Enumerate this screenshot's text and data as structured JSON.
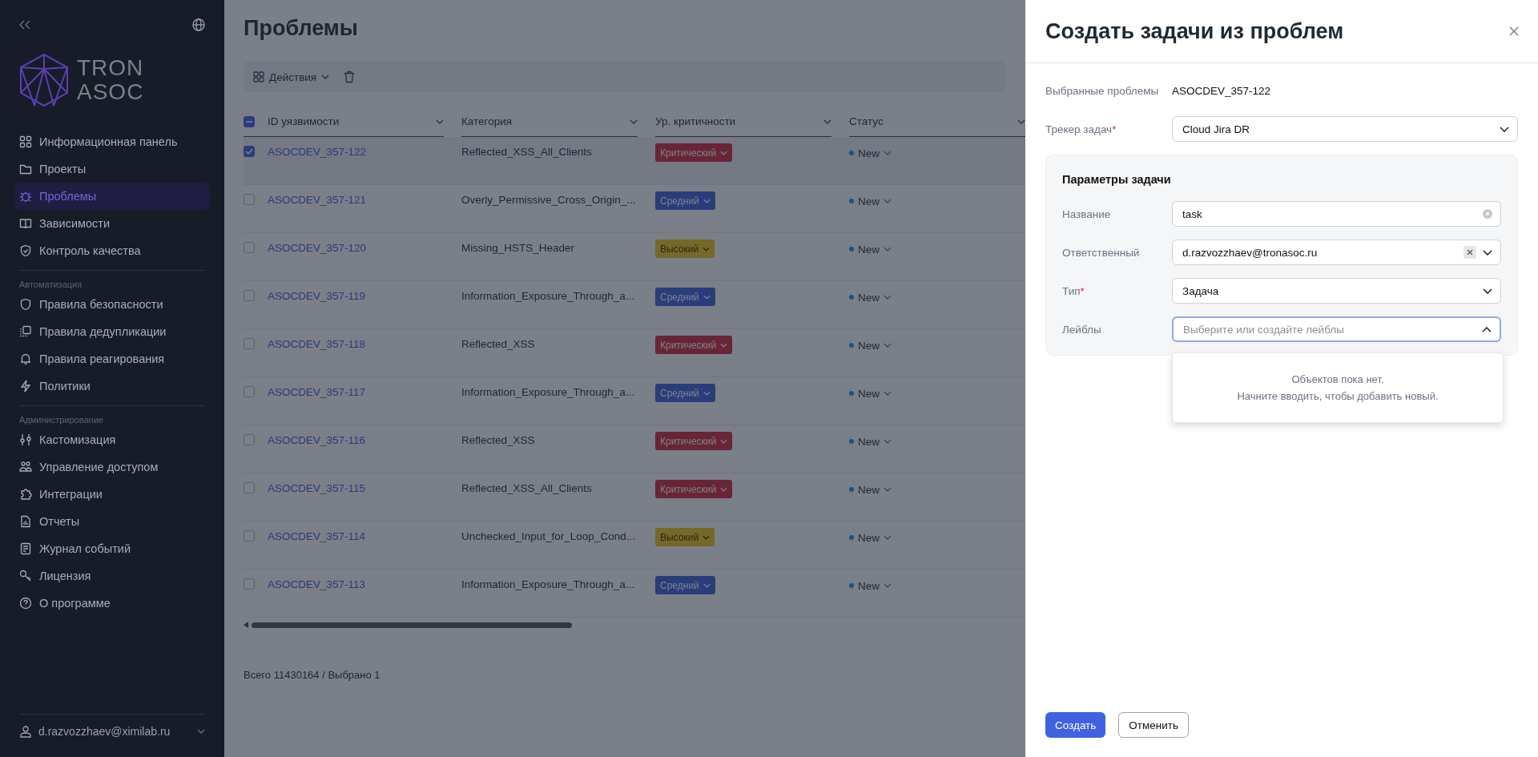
{
  "sidebar": {
    "logo": [
      "TRON",
      "ASOC"
    ],
    "groups": [
      {
        "items": [
          {
            "label": "Информационная панель",
            "selected": false
          },
          {
            "label": "Проекты",
            "selected": false
          },
          {
            "label": "Проблемы",
            "selected": true
          },
          {
            "label": "Зависимости",
            "selected": false
          },
          {
            "label": "Контроль качества",
            "selected": false
          }
        ]
      },
      {
        "heading": "Автоматизация",
        "items": [
          {
            "label": "Правила безопасности",
            "selected": false
          },
          {
            "label": "Правила дедупликации",
            "selected": false
          },
          {
            "label": "Правила реагирования",
            "selected": false
          },
          {
            "label": "Политики",
            "selected": false
          }
        ]
      },
      {
        "heading": "Администрирование",
        "items": [
          {
            "label": "Кастомизация",
            "selected": false
          },
          {
            "label": "Управление доступом",
            "selected": false
          },
          {
            "label": "Интеграции",
            "selected": false
          },
          {
            "label": "Отчеты",
            "selected": false
          },
          {
            "label": "Журнал событий",
            "selected": false
          },
          {
            "label": "Лицензия",
            "selected": false
          },
          {
            "label": "О программе",
            "selected": false
          }
        ]
      }
    ],
    "user": "d.razvozzhaev@ximilab.ru"
  },
  "page": {
    "title": "Проблемы",
    "toolbar": {
      "actions": "Действия"
    },
    "table": {
      "header_checkbox": {
        "indeterminate": true
      },
      "columns": [
        "ID уязвимости",
        "Категория",
        "Ур. критичности",
        "Статус"
      ],
      "rows": [
        {
          "id": "ASOCDEV_357-122",
          "category": "Reflected_XSS_All_Clients",
          "severity": {
            "label": "Критический",
            "kind": "critical"
          },
          "status": "New",
          "checked": true
        },
        {
          "id": "ASOCDEV_357-121",
          "category": "Overly_Permissive_Cross_Origin_...",
          "severity": {
            "label": "Средний",
            "kind": "medium"
          },
          "status": "New",
          "checked": false
        },
        {
          "id": "ASOCDEV_357-120",
          "category": "Missing_HSTS_Header",
          "severity": {
            "label": "Высокий",
            "kind": "high"
          },
          "status": "New",
          "checked": false
        },
        {
          "id": "ASOCDEV_357-119",
          "category": "Information_Exposure_Through_a...",
          "severity": {
            "label": "Средний",
            "kind": "medium"
          },
          "status": "New",
          "checked": false
        },
        {
          "id": "ASOCDEV_357-118",
          "category": "Reflected_XSS",
          "severity": {
            "label": "Критический",
            "kind": "critical"
          },
          "status": "New",
          "checked": false
        },
        {
          "id": "ASOCDEV_357-117",
          "category": "Information_Exposure_Through_a...",
          "severity": {
            "label": "Средний",
            "kind": "medium"
          },
          "status": "New",
          "checked": false
        },
        {
          "id": "ASOCDEV_357-116",
          "category": "Reflected_XSS",
          "severity": {
            "label": "Критический",
            "kind": "critical"
          },
          "status": "New",
          "checked": false
        },
        {
          "id": "ASOCDEV_357-115",
          "category": "Reflected_XSS_All_Clients",
          "severity": {
            "label": "Критический",
            "kind": "critical"
          },
          "status": "New",
          "checked": false
        },
        {
          "id": "ASOCDEV_357-114",
          "category": "Unchecked_Input_for_Loop_Cond...",
          "severity": {
            "label": "Высокий",
            "kind": "high"
          },
          "status": "New",
          "checked": false
        },
        {
          "id": "ASOCDEV_357-113",
          "category": "Information_Exposure_Through_a...",
          "severity": {
            "label": "Средний",
            "kind": "medium"
          },
          "status": "New",
          "checked": false
        }
      ]
    },
    "footer": "Всего 11430164 / Выбрано 1"
  },
  "dialog": {
    "title": "Создать задачи из проблем",
    "selected_label": "Выбранные проблемы",
    "selected_value": "ASOCDEV_357-122",
    "tracker": {
      "label": "Трекер задач",
      "required_mark": "*",
      "value": "Cloud Jira DR"
    },
    "params": {
      "title": "Параметры задачи",
      "fields": [
        {
          "kind": "text",
          "label": "Название",
          "value": "task"
        },
        {
          "kind": "select",
          "label": "Ответственный",
          "value": "d.razvozzhaev@tronasoc.ru",
          "clearable": true
        },
        {
          "kind": "select",
          "label": "Тип",
          "required_mark": "*",
          "value": "Задача",
          "clearable": false
        },
        {
          "kind": "multiselect",
          "label": "Лейблы",
          "placeholder": "Выберите или создайте лейблы",
          "expanded": true
        }
      ]
    },
    "dropdown_empty": [
      "Объектов пока нет.",
      "Начните вводить, чтобы добавить новый."
    ],
    "buttons": [
      {
        "label": "Создать",
        "kind": "primary"
      },
      {
        "label": "Отменить",
        "kind": "secondary"
      }
    ]
  }
}
